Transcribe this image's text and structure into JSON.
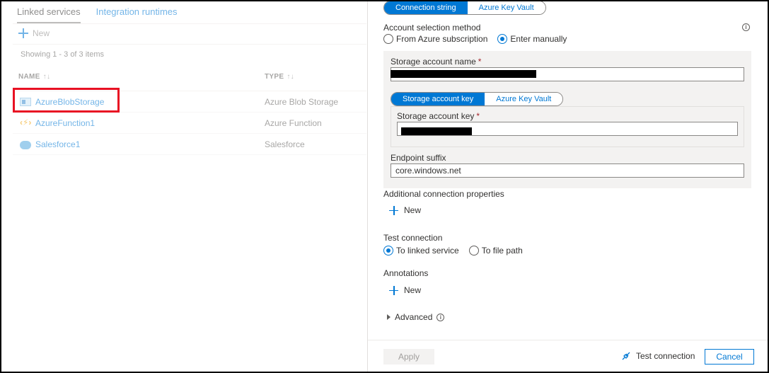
{
  "left_panel": {
    "tabs": [
      {
        "label": "Linked services",
        "active": true
      },
      {
        "label": "Integration runtimes",
        "active": false
      }
    ],
    "new_label": "New",
    "showing_text": "Showing 1 - 3 of 3 items",
    "columns": {
      "name": "NAME",
      "type": "TYPE",
      "sort_glyph": "↑↓"
    },
    "rows": [
      {
        "name": "AzureBlobStorage",
        "type": "Azure Blob Storage",
        "icon": "blob-storage-icon",
        "highlighted": true
      },
      {
        "name": "AzureFunction1",
        "type": "Azure Function",
        "icon": "azure-function-icon",
        "highlighted": false
      },
      {
        "name": "Salesforce1",
        "type": "Salesforce",
        "icon": "salesforce-icon",
        "highlighted": false
      }
    ],
    "highlight_color": "#e81123"
  },
  "right_panel": {
    "connection_toggle": {
      "options": [
        "Connection string",
        "Azure Key Vault"
      ],
      "selected": "Connection string"
    },
    "account_selection": {
      "label": "Account selection method",
      "options": [
        "From Azure subscription",
        "Enter manually"
      ],
      "selected": "Enter manually",
      "info_glyph": "i"
    },
    "storage_account_name": {
      "label": "Storage account name",
      "required_mark": "*",
      "value_redacted": true
    },
    "key_toggle": {
      "options": [
        "Storage account key",
        "Azure Key Vault"
      ],
      "selected": "Storage account key"
    },
    "storage_account_key": {
      "label": "Storage account key",
      "required_mark": "*",
      "value_redacted": true
    },
    "endpoint_suffix": {
      "label": "Endpoint suffix",
      "value": "core.windows.net"
    },
    "additional_properties": {
      "label": "Additional connection properties",
      "new_label": "New"
    },
    "test_connection": {
      "label": "Test connection",
      "options": [
        "To linked service",
        "To file path"
      ],
      "selected": "To linked service"
    },
    "annotations": {
      "label": "Annotations",
      "new_label": "New"
    },
    "advanced": {
      "label": "Advanced",
      "info_glyph": "i"
    },
    "footer": {
      "apply_label": "Apply",
      "test_connection_label": "Test connection",
      "cancel_label": "Cancel"
    },
    "accent_color": "#0078d4"
  }
}
